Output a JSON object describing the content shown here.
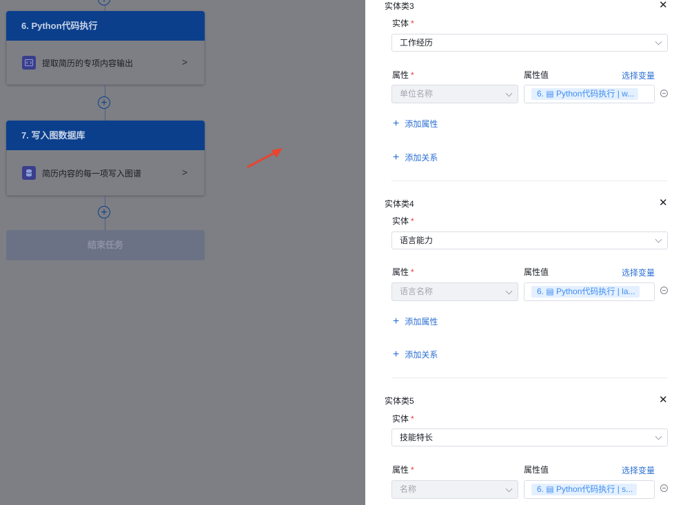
{
  "workflow": {
    "node6": {
      "title": "6. Python代码执行",
      "body": "提取简历的专项内容输出",
      "icon": "code-icon"
    },
    "node7": {
      "title": "7. 写入图数据库",
      "body": "简历内容的每一项写入图谱",
      "icon": "database-icon"
    },
    "end_label": "结束任务"
  },
  "drawer": {
    "sections": [
      {
        "title": "实体类3",
        "entity_label": "实体",
        "entity_value": "工作经历",
        "attr_label": "属性",
        "attr_value_label": "属性值",
        "select_var": "选择变量",
        "attr_placeholder": "单位名称",
        "attr_tag": "6. ▤ Python代码执行 | w...",
        "add_attr": "添加属性",
        "add_rel": "添加关系"
      },
      {
        "title": "实体类4",
        "entity_label": "实体",
        "entity_value": "语言能力",
        "attr_label": "属性",
        "attr_value_label": "属性值",
        "select_var": "选择变量",
        "attr_placeholder": "语言名称",
        "attr_tag": "6. ▤ Python代码执行 | la...",
        "add_attr": "添加属性",
        "add_rel": "添加关系"
      },
      {
        "title": "实体类5",
        "entity_label": "实体",
        "entity_value": "技能特长",
        "attr_label": "属性",
        "attr_value_label": "属性值",
        "select_var": "选择变量",
        "attr_placeholder": "名称",
        "attr_tag": "6. ▤ Python代码执行 | s..."
      }
    ]
  },
  "colors": {
    "node_header": "#0b3f8c",
    "link_blue": "#2b6fd4",
    "tag_bg": "#e4f0ff",
    "required": "#e53935",
    "pointer_arrow": "#e8442f"
  }
}
